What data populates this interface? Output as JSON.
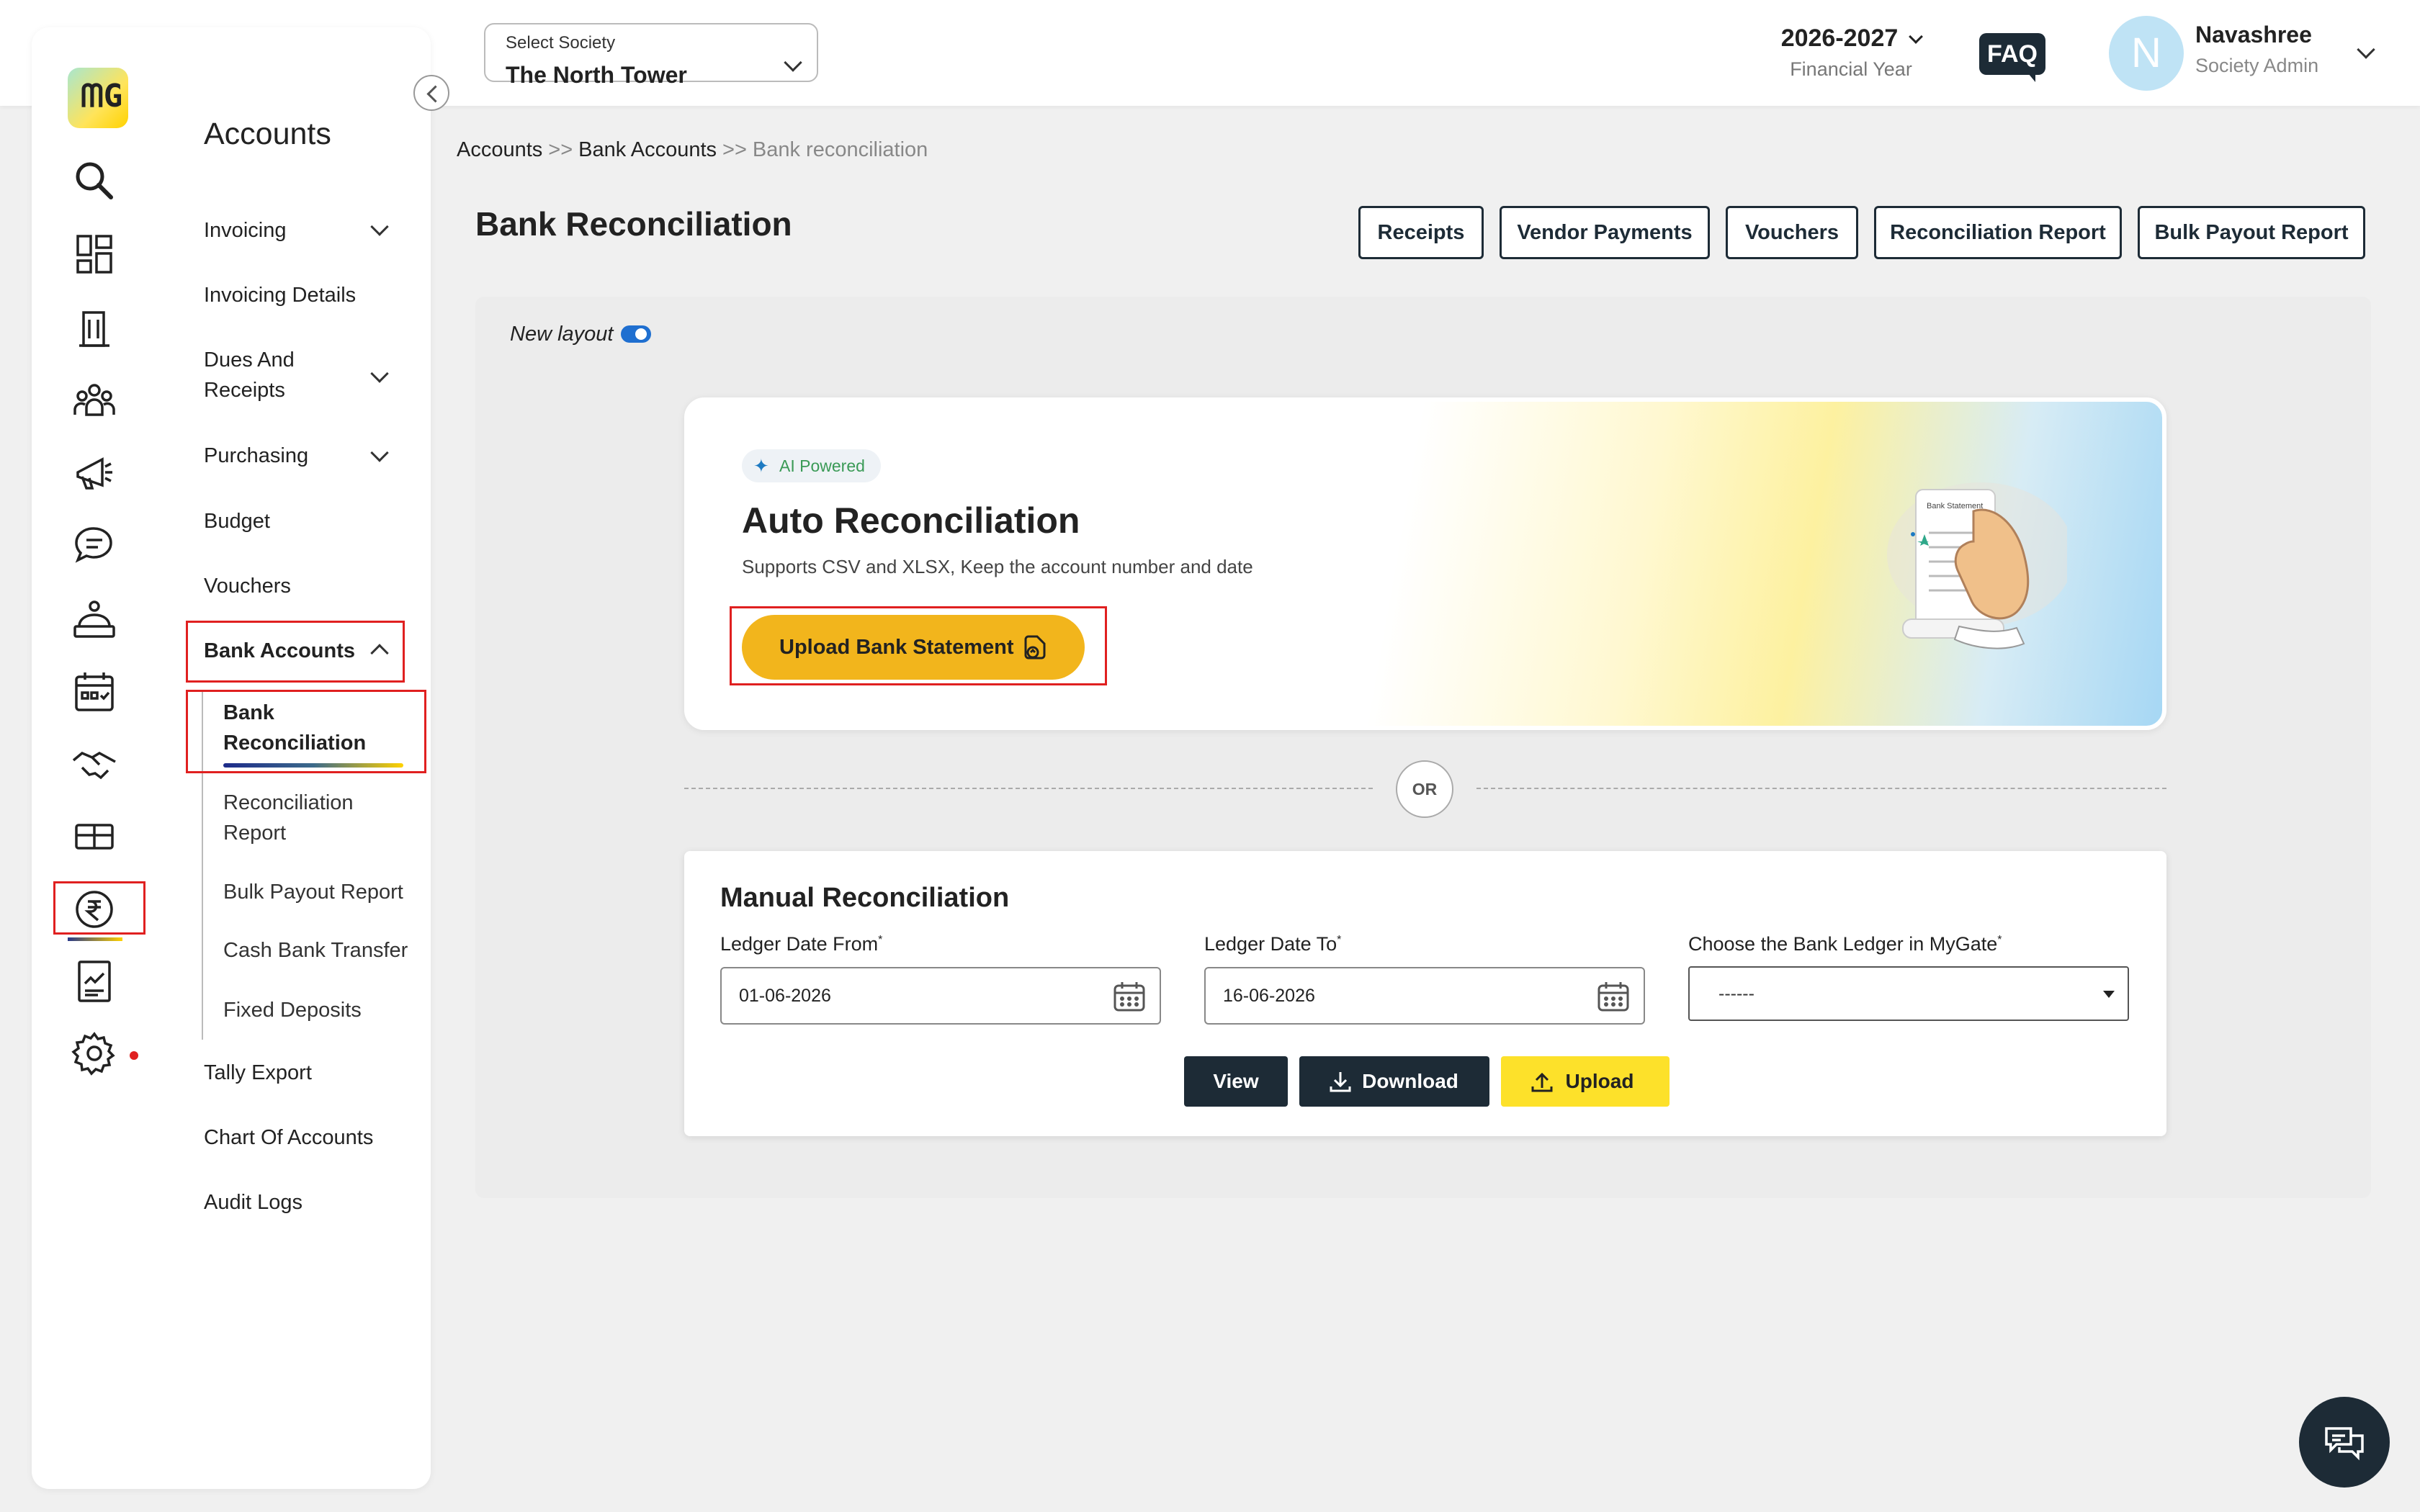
{
  "header": {
    "society_label": "Select Society",
    "society_value": "The North Tower",
    "financial_year": "2026-2027",
    "financial_year_label": "Financial Year",
    "faq_label": "FAQ",
    "avatar_letter": "N",
    "user_name": "Navashree",
    "user_role": "Society Admin"
  },
  "rail": {
    "logo_text": "ᗰG",
    "icons": [
      "search-icon",
      "dashboard-icon",
      "building-icon",
      "community-icon",
      "announcement-icon",
      "chat-icon",
      "helpdesk-icon",
      "calendar-icon",
      "handshake-icon",
      "amenity-icon",
      "rupee-icon",
      "reports-icon",
      "settings-icon"
    ]
  },
  "sidebar": {
    "title": "Accounts",
    "items": [
      {
        "label": "Invoicing"
      },
      {
        "label": "Invoicing Details"
      },
      {
        "label": "Dues And Receipts"
      },
      {
        "label": "Purchasing"
      },
      {
        "label": "Budget"
      },
      {
        "label": "Vouchers"
      },
      {
        "label": "Bank Accounts"
      },
      {
        "label": "Tally Export"
      },
      {
        "label": "Chart Of Accounts"
      },
      {
        "label": "Audit Logs"
      }
    ],
    "bank_sub_items": [
      {
        "label": "Bank Reconciliation"
      },
      {
        "label": "Reconciliation Report"
      },
      {
        "label": "Bulk Payout Report"
      },
      {
        "label": "Cash Bank Transfer"
      },
      {
        "label": "Fixed Deposits"
      }
    ]
  },
  "breadcrumb": {
    "items": [
      "Accounts",
      "Bank Accounts",
      "Bank reconciliation"
    ],
    "separator": ">>"
  },
  "page": {
    "title": "Bank Reconciliation",
    "nav_buttons": [
      "Receipts",
      "Vendor Payments",
      "Vouchers",
      "Reconciliation Report",
      "Bulk Payout Report"
    ],
    "new_layout_label": "New layout",
    "new_layout_on": true
  },
  "auto": {
    "badge": "AI Powered",
    "title": "Auto Reconciliation",
    "subtitle": "Supports CSV and XLSX, Keep the account number and date",
    "upload_label": "Upload Bank Statement",
    "illustration_caption": "Bank Statement"
  },
  "or_label": "OR",
  "manual": {
    "title": "Manual Reconciliation",
    "from_label": "Ledger Date From",
    "from_value": "01-06-2026",
    "to_label": "Ledger Date To",
    "to_value": "16-06-2026",
    "ledger_label": "Choose the Bank Ledger in MyGate",
    "ledger_value": "------",
    "required_mark": "*",
    "view_label": "View",
    "download_label": "Download",
    "upload_label": "Upload"
  },
  "colors": {
    "primary_dark": "#1d2b36",
    "accent_yellow": "#fde12a",
    "upload_statement": "#f2b51c",
    "highlight_red": "#e02020",
    "toggle_blue": "#1f6fd0"
  }
}
